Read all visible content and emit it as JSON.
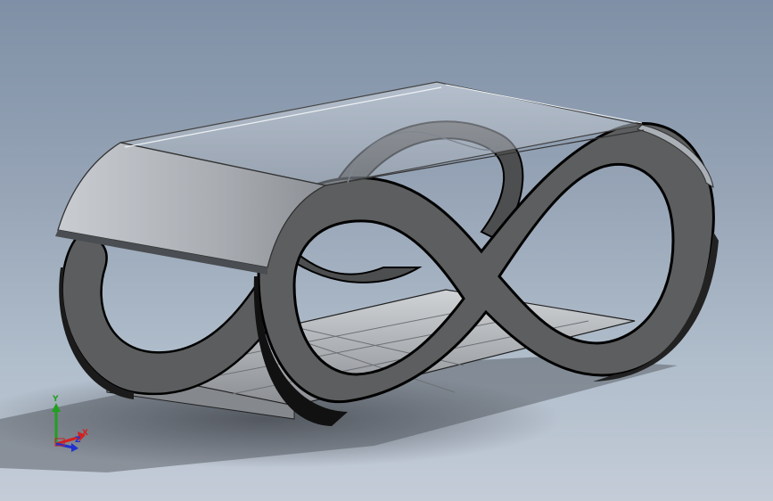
{
  "viewport": {
    "background_top": "#7f90a6",
    "background_bottom": "#c4ccd8",
    "model_face_color": "#5c5d5e",
    "model_edge_color": "#000000",
    "glass_color": "#c8d0d8",
    "shelf_color": "#a8abae"
  },
  "triad": {
    "x_label": "X",
    "y_label": "Y",
    "z_label": "Z",
    "x_color": "#d42020",
    "y_color": "#20a020",
    "z_color": "#2030d0"
  }
}
